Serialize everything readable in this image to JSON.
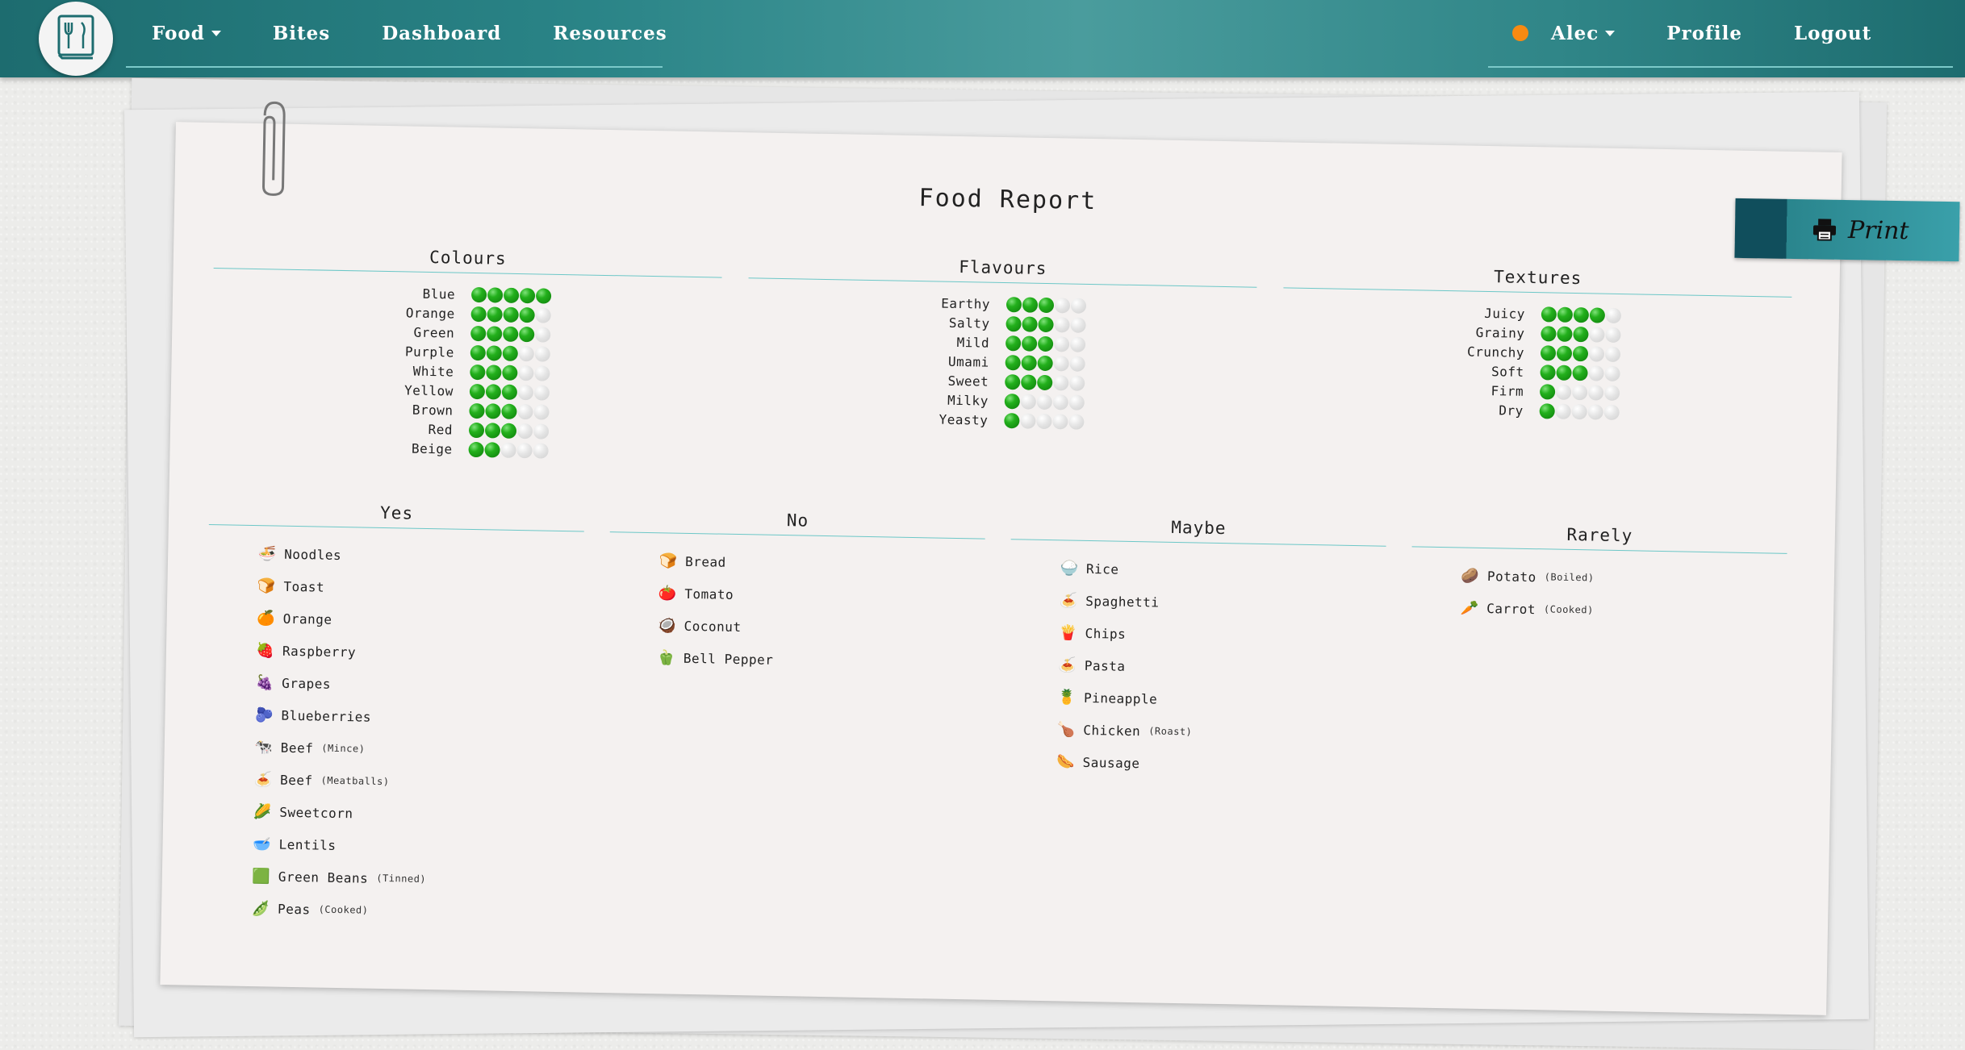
{
  "nav": {
    "logo_icon": "book-fork-knife-icon",
    "left": [
      {
        "label": "Food",
        "dropdown": true
      },
      {
        "label": "Bites",
        "dropdown": false
      },
      {
        "label": "Dashboard",
        "dropdown": false
      },
      {
        "label": "Resources",
        "dropdown": false
      }
    ],
    "right": {
      "status_color": "#f78a12",
      "user_label": "Alec",
      "profile_label": "Profile",
      "logout_label": "Logout"
    }
  },
  "report": {
    "title": "Food Report",
    "print_label": "Print",
    "ratings": [
      {
        "title": "Colours",
        "items": [
          {
            "label": "Blue",
            "value": 5
          },
          {
            "label": "Orange",
            "value": 4
          },
          {
            "label": "Green",
            "value": 4
          },
          {
            "label": "Purple",
            "value": 3
          },
          {
            "label": "White",
            "value": 3
          },
          {
            "label": "Yellow",
            "value": 3
          },
          {
            "label": "Brown",
            "value": 3
          },
          {
            "label": "Red",
            "value": 3
          },
          {
            "label": "Beige",
            "value": 2
          }
        ]
      },
      {
        "title": "Flavours",
        "items": [
          {
            "label": "Earthy",
            "value": 3
          },
          {
            "label": "Salty",
            "value": 3
          },
          {
            "label": "Mild",
            "value": 3
          },
          {
            "label": "Umami",
            "value": 3
          },
          {
            "label": "Sweet",
            "value": 3
          },
          {
            "label": "Milky",
            "value": 1
          },
          {
            "label": "Yeasty",
            "value": 1
          }
        ]
      },
      {
        "title": "Textures",
        "items": [
          {
            "label": "Juicy",
            "value": 4
          },
          {
            "label": "Grainy",
            "value": 3
          },
          {
            "label": "Crunchy",
            "value": 3
          },
          {
            "label": "Soft",
            "value": 3
          },
          {
            "label": "Firm",
            "value": 1
          },
          {
            "label": "Dry",
            "value": 1
          }
        ]
      }
    ],
    "lists": [
      {
        "title": "Yes",
        "items": [
          {
            "emoji": "🍜",
            "name": "Noodles",
            "note": ""
          },
          {
            "emoji": "🍞",
            "name": "Toast",
            "note": ""
          },
          {
            "emoji": "🍊",
            "name": "Orange",
            "note": ""
          },
          {
            "emoji": "🍓",
            "name": "Raspberry",
            "note": ""
          },
          {
            "emoji": "🍇",
            "name": "Grapes",
            "note": ""
          },
          {
            "emoji": "🫐",
            "name": "Blueberries",
            "note": ""
          },
          {
            "emoji": "🐄",
            "name": "Beef",
            "note": "(Mince)"
          },
          {
            "emoji": "🍝",
            "name": "Beef",
            "note": "(Meatballs)"
          },
          {
            "emoji": "🌽",
            "name": "Sweetcorn",
            "note": ""
          },
          {
            "emoji": "🥣",
            "name": "Lentils",
            "note": ""
          },
          {
            "emoji": "🟩",
            "name": "Green Beans",
            "note": "(Tinned)"
          },
          {
            "emoji": "🫛",
            "name": "Peas",
            "note": "(Cooked)"
          }
        ]
      },
      {
        "title": "No",
        "items": [
          {
            "emoji": "🍞",
            "name": "Bread",
            "note": ""
          },
          {
            "emoji": "🍅",
            "name": "Tomato",
            "note": ""
          },
          {
            "emoji": "🥥",
            "name": "Coconut",
            "note": ""
          },
          {
            "emoji": "🫑",
            "name": "Bell Pepper",
            "note": ""
          }
        ]
      },
      {
        "title": "Maybe",
        "items": [
          {
            "emoji": "🍚",
            "name": "Rice",
            "note": ""
          },
          {
            "emoji": "🍝",
            "name": "Spaghetti",
            "note": ""
          },
          {
            "emoji": "🍟",
            "name": "Chips",
            "note": ""
          },
          {
            "emoji": "🍝",
            "name": "Pasta",
            "note": ""
          },
          {
            "emoji": "🍍",
            "name": "Pineapple",
            "note": ""
          },
          {
            "emoji": "🍗",
            "name": "Chicken",
            "note": "(Roast)"
          },
          {
            "emoji": "🌭",
            "name": "Sausage",
            "note": ""
          }
        ]
      },
      {
        "title": "Rarely",
        "items": [
          {
            "emoji": "🥔",
            "name": "Potato",
            "note": "(Boiled)"
          },
          {
            "emoji": "🥕",
            "name": "Carrot",
            "note": "(Cooked)"
          }
        ]
      }
    ]
  }
}
